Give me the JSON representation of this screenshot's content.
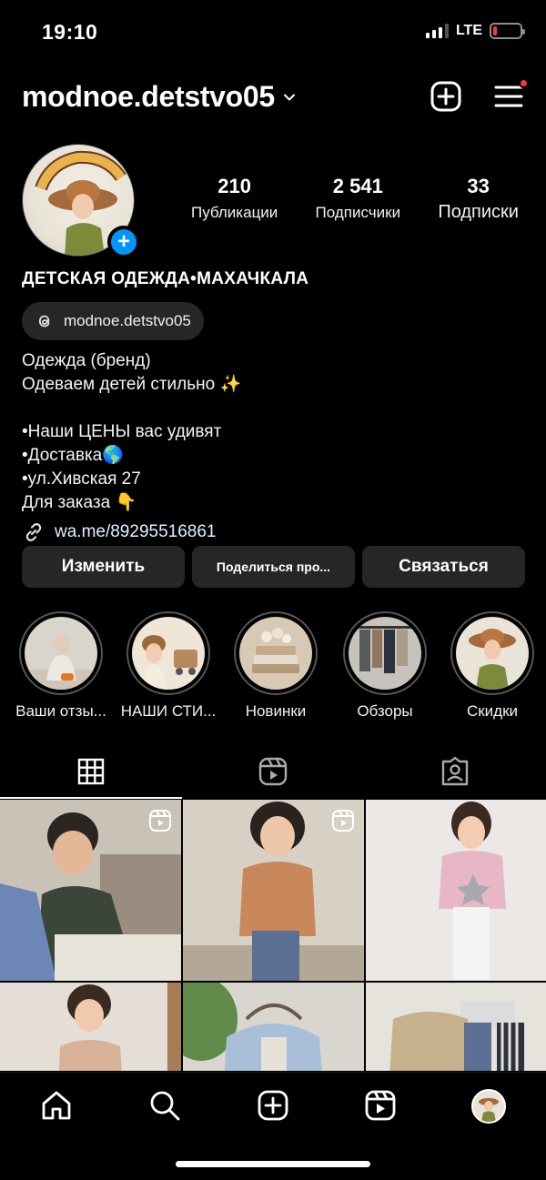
{
  "status_bar": {
    "time": "19:10",
    "network": "LTE",
    "battery_level_fraction": 0.15
  },
  "header": {
    "username": "modnoe.detstvo05"
  },
  "profile": {
    "stats": [
      {
        "value": "210",
        "label": "Публикации"
      },
      {
        "value": "2 541",
        "label": "Подписчики"
      },
      {
        "value": "33",
        "label": "Подписки"
      }
    ],
    "name": "ДЕТСКАЯ ОДЕЖДА•МАХАЧКАЛА",
    "threads_handle": "modnoe.detstvo05",
    "bio": "Одежда (бренд)\nОдеваем детей стильно ✨\n\n•Наши ЦЕНЫ вас удивят\n•Доставка🌎\n•ул.Хивская 27\nДля заказа 👇",
    "link": "wa.me/89295516861"
  },
  "actions": {
    "edit": "Изменить",
    "share": "Поделиться про...",
    "contact": "Связаться"
  },
  "highlights": [
    {
      "label": "Ваши отзы...",
      "color": "#d9d4cc"
    },
    {
      "label": "НАШИ СТИ...",
      "color": "#efe6d8"
    },
    {
      "label": "Новинки",
      "color": "#d8c9b4"
    },
    {
      "label": "Обзоры",
      "color": "#c7c2bb"
    },
    {
      "label": "Скидки",
      "color": "#e9e4d7"
    }
  ],
  "tabs": [
    "posts-grid",
    "reels",
    "tagged"
  ],
  "grid_posts": [
    {
      "kind": "reel",
      "bg": "#bdb6ab",
      "accent": "#6d86b8"
    },
    {
      "kind": "reel",
      "bg": "#d9d2c6",
      "accent": "#c9875c"
    },
    {
      "kind": "photo",
      "bg": "#e9e6e4",
      "accent": "#e7b7c5"
    },
    {
      "kind": "photo",
      "bg": "#e3ddd6",
      "accent": "#d9b29a"
    },
    {
      "kind": "photo",
      "bg": "#ddd9d2",
      "accent": "#a9bfd8"
    },
    {
      "kind": "photo",
      "bg": "#e6e2dc",
      "accent": "#c7b08c"
    }
  ],
  "colors": {
    "accent_blue": "#0095f6",
    "notification_red": "#ff3040",
    "button_bg": "#262626"
  }
}
